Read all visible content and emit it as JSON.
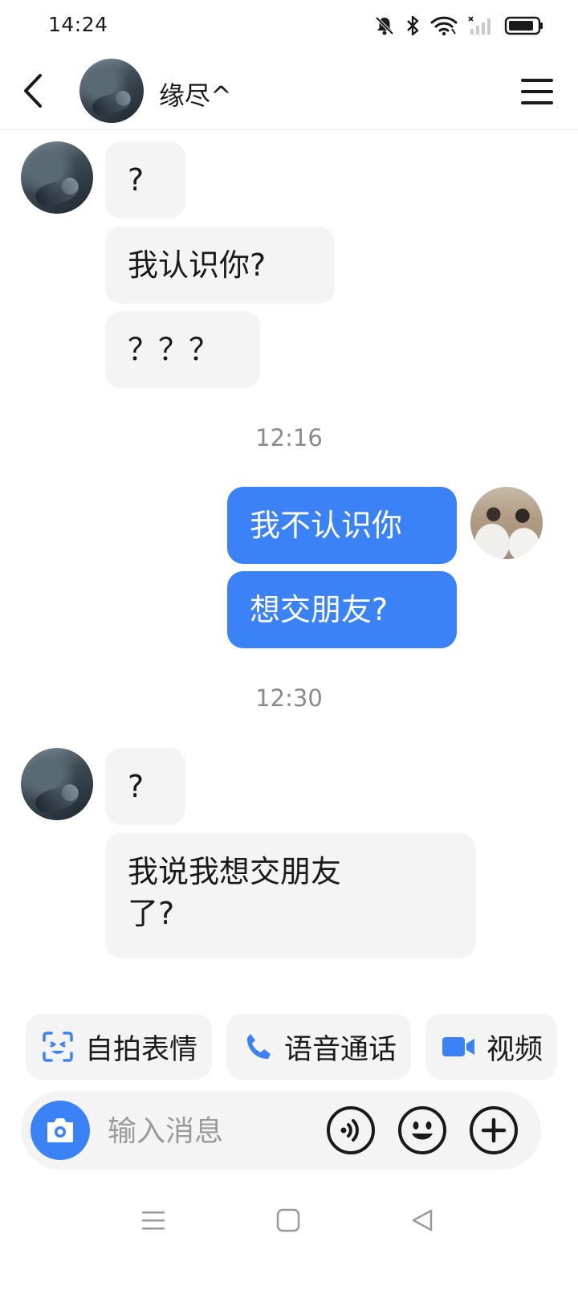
{
  "status_bar": {
    "time": "14:24",
    "icons": [
      "mute-bell-icon",
      "bluetooth-icon",
      "wifi-icon",
      "signal-icon",
      "battery-icon"
    ]
  },
  "header": {
    "contact_name": "缘尽^",
    "icons": [
      "back-arrow-icon",
      "menu-icon"
    ]
  },
  "messages": [
    {
      "side": "in",
      "text": "?"
    },
    {
      "side": "in",
      "text": "我认识你?"
    },
    {
      "side": "in",
      "text": "？？？"
    },
    {
      "type": "time",
      "text": "12:16"
    },
    {
      "side": "out",
      "text": "我不认识你"
    },
    {
      "side": "out",
      "text": "想交朋友?"
    },
    {
      "type": "time",
      "text": "12:30"
    },
    {
      "side": "in",
      "text": "?"
    },
    {
      "side": "in",
      "text": "我说我想交朋友\n了?"
    }
  ],
  "quick_actions": [
    {
      "label": "自拍表情",
      "icon": "selfie-face-icon"
    },
    {
      "label": "语音通话",
      "icon": "phone-icon"
    },
    {
      "label": "视频",
      "icon": "video-camera-icon"
    }
  ],
  "input": {
    "placeholder": "输入消息",
    "value": "",
    "icons": [
      "camera-icon",
      "voice-icon",
      "emoji-icon",
      "plus-icon"
    ]
  },
  "colors": {
    "accent": "#3b82f6",
    "bubble_in": "#f4f4f4",
    "bubble_out": "#3b82f6",
    "timestamp": "#8a8a8a"
  }
}
